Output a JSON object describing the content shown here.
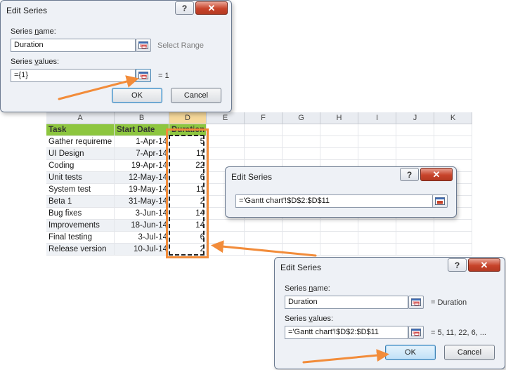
{
  "dialog_top": {
    "title": "Edit Series",
    "help_btn": "?",
    "close_btn": "✕",
    "series_name_label_pre": "Series ",
    "series_name_label_u": "n",
    "series_name_label_post": "ame:",
    "series_name_value": "Duration",
    "select_range_text": "Select Range",
    "series_values_label_pre": "Series ",
    "series_values_label_u": "v",
    "series_values_label_post": "alues:",
    "series_values_value": "={1}",
    "series_values_result": "= 1",
    "ok_label": "OK",
    "cancel_label": "Cancel"
  },
  "dialog_mid": {
    "title": "Edit Series",
    "help_btn": "?",
    "close_btn": "✕",
    "range_value": "='Gantt chart'!$D$2:$D$11"
  },
  "dialog_bottom": {
    "title": "Edit Series",
    "help_btn": "?",
    "close_btn": "✕",
    "series_name_label_pre": "Series ",
    "series_name_label_u": "n",
    "series_name_label_post": "ame:",
    "series_name_value": "Duration",
    "series_name_result": "= Duration",
    "series_values_label_pre": "Series ",
    "series_values_label_u": "v",
    "series_values_label_post": "alues:",
    "series_values_value": "='Gantt chart'!$D$2:$D$11",
    "series_values_result": "= 5, 11, 22, 6, ...",
    "ok_label": "OK",
    "cancel_label": "Cancel"
  },
  "sheet": {
    "columns": [
      "A",
      "B",
      "D",
      "E",
      "F",
      "G",
      "H",
      "I",
      "J",
      "K"
    ],
    "header": {
      "task": "Task",
      "start": "Start Date",
      "duration": "Duration"
    },
    "rows": [
      {
        "task": "Gather requireme",
        "start": "1-Apr-14",
        "duration": "5"
      },
      {
        "task": "UI Design",
        "start": "7-Apr-14",
        "duration": "11"
      },
      {
        "task": "Coding",
        "start": "19-Apr-14",
        "duration": "22"
      },
      {
        "task": "Unit tests",
        "start": "12-May-14",
        "duration": "6"
      },
      {
        "task": "System test",
        "start": "19-May-14",
        "duration": "11"
      },
      {
        "task": "Beta 1",
        "start": "31-May-14",
        "duration": "2"
      },
      {
        "task": "Bug fixes",
        "start": "3-Jun-14",
        "duration": "14"
      },
      {
        "task": "Improvements",
        "start": "18-Jun-14",
        "duration": "14"
      },
      {
        "task": "Final testing",
        "start": "3-Jul-14",
        "duration": "6"
      },
      {
        "task": "Release version",
        "start": "10-Jul-14",
        "duration": "2"
      }
    ]
  },
  "colors": {
    "accent_arrow": "#f28c3a",
    "header_fill": "#8dc63f",
    "selected_col": "#f6d89a"
  },
  "icons": {
    "range_selector": "collapse-dialog-icon"
  }
}
